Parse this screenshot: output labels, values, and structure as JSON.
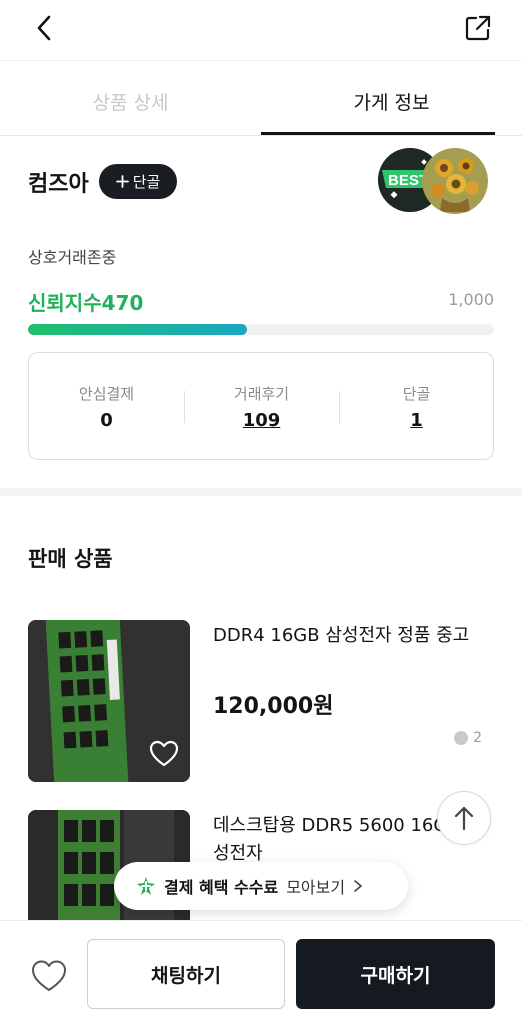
{
  "header": {
    "back_icon": "chevron-left-icon",
    "share_icon": "share-external-icon"
  },
  "tabs": [
    {
      "label": "상품 상세",
      "active": false
    },
    {
      "label": "가게 정보",
      "active": true
    }
  ],
  "store": {
    "name": "컴즈아",
    "regular_button": "단골",
    "badge_text": "BEST",
    "description": "상호거래존중",
    "trust_label": "신뢰지수",
    "trust_value": "470",
    "trust_max": "1,000",
    "trust_fraction": 0.47
  },
  "stats": [
    {
      "label": "안심결제",
      "value": "0",
      "link": false
    },
    {
      "label": "거래후기",
      "value": "109",
      "link": true
    },
    {
      "label": "단골",
      "value": "1",
      "link": true
    }
  ],
  "products_section": {
    "title": "판매 상품",
    "items": [
      {
        "title": "DDR4 16GB 삼성전자 정품 중고",
        "price": "120,000원",
        "chat_count": "2"
      },
      {
        "title": "데스크탑용 DDR5 5600 16GB 삼성전자",
        "price": "",
        "chat_count": ""
      }
    ]
  },
  "promo": {
    "strong": "결제 혜택 수수료",
    "rest": "모아보기"
  },
  "bottom_bar": {
    "chat_button": "채팅하기",
    "buy_button": "구매하기"
  },
  "colors": {
    "accent_green": "#1fb25a",
    "dark_button": "#141a20",
    "progress_start": "#1ec06a",
    "progress_end": "#18a8c6"
  }
}
